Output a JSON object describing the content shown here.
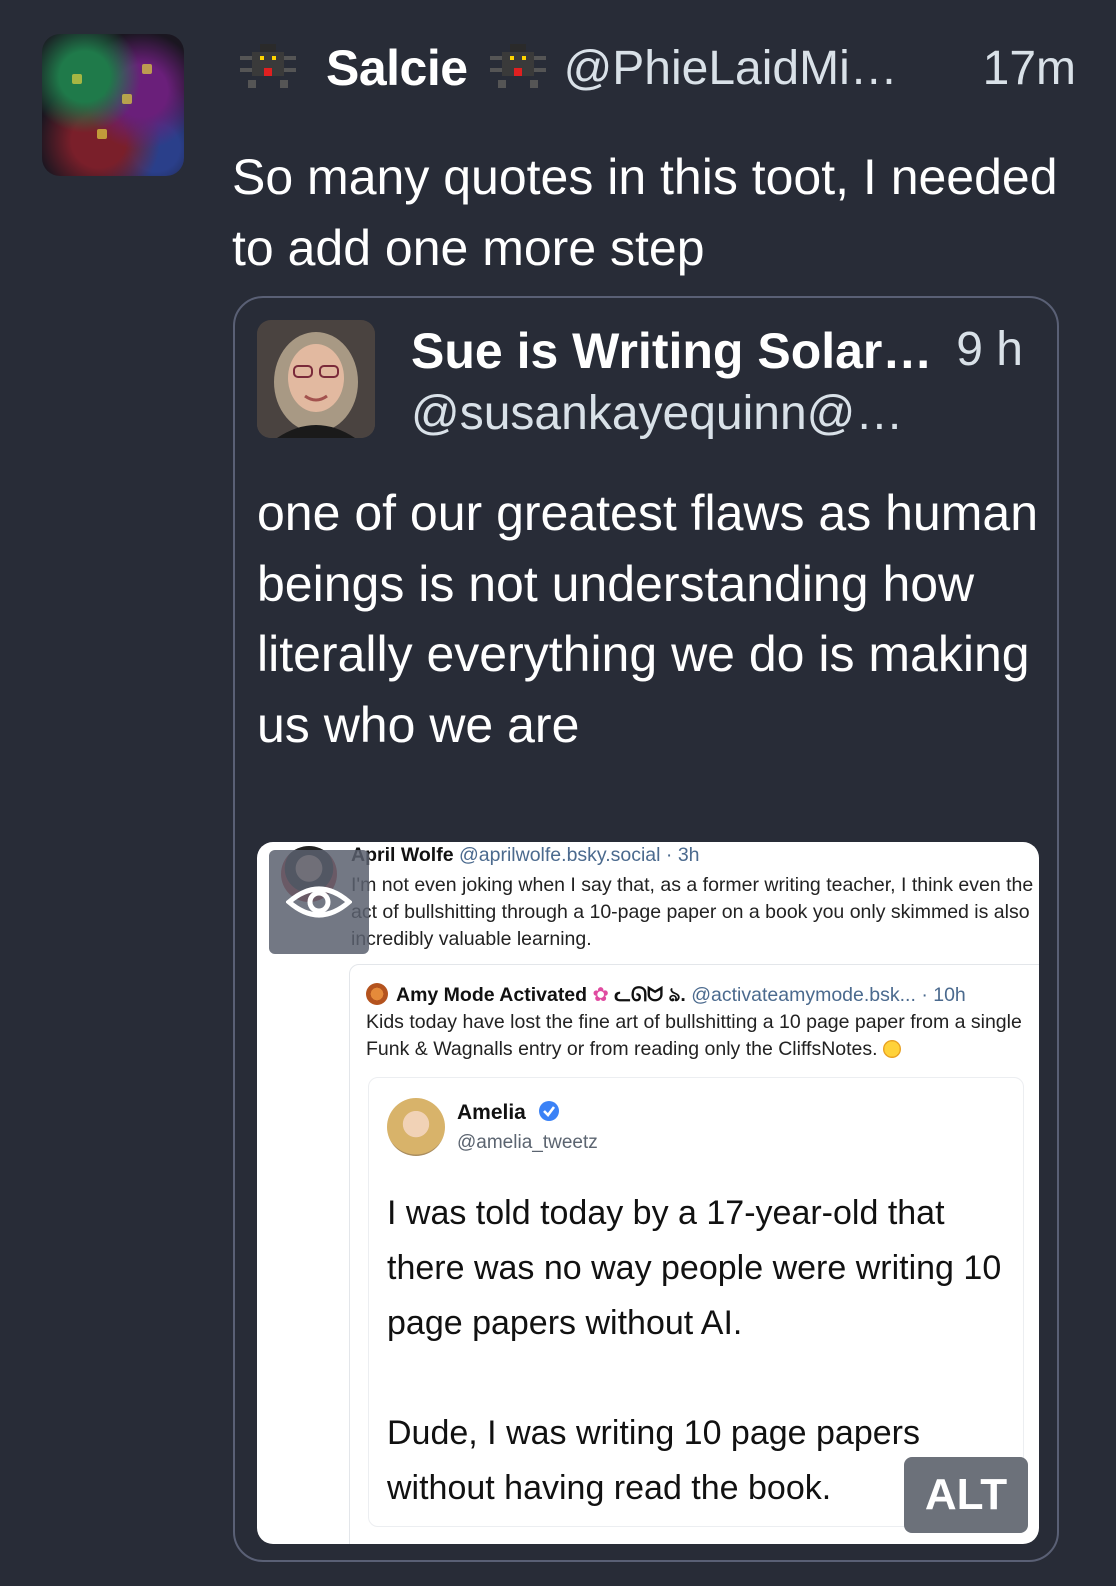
{
  "post": {
    "author_name": "Salcie",
    "author_handle": "@PhieLaidMi…",
    "time": "17m",
    "text": "So many quotes in this toot, I needed to add one more step",
    "avatar_icon": "glitch-art-avatar",
    "emoji_icon": "pixel-bug-icon"
  },
  "quote": {
    "author_name": "Sue is Writing Solar…",
    "author_handle": "@susankayequinn@…",
    "time": "9 h",
    "text": "one of our greatest flaws as human beings is not understanding how literally everything we do is making us who we are"
  },
  "media": {
    "alt_label": "ALT",
    "hide_icon": "eye-icon",
    "post1": {
      "name": "April Wolfe",
      "handle": "@aprilwolfe.bsky.social",
      "time": "· 3h",
      "text": "I'm not even joking when I say that, as a former writing teacher, I think even the act of bullshitting through a 10-page paper on a book you only skimmed is also incredibly valuable learning."
    },
    "post2": {
      "name": "Amy Mode Activated",
      "name_suffix": "ᓚᘏᗢ ঌ.",
      "handle": "@activateamymode.bsk...",
      "time": "· 10h",
      "text": "Kids today have lost the fine art of bullshitting a 10 page paper from a single Funk & Wagnalls entry or from reading only the CliffsNotes."
    },
    "post3": {
      "name": "Amelia",
      "handle": "@amelia_tweetz",
      "text": "I was told today by a 17-year-old that there was no way people were writing 10 page papers without AI.\n\nDude, I was writing 10 page papers without having read the book."
    }
  }
}
